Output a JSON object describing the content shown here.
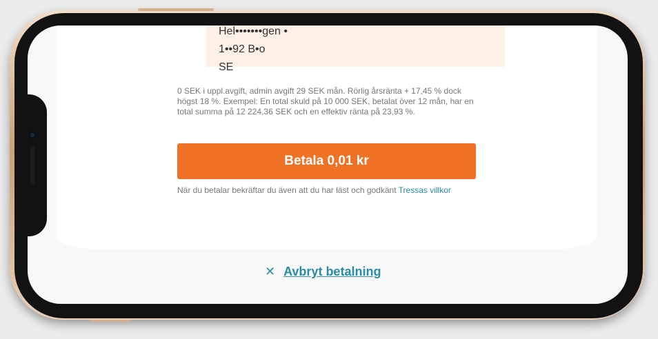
{
  "address": {
    "street": "Hel•••••••gen •",
    "postal": "1••92 B•o",
    "country": "SE"
  },
  "disclaimer": "0 SEK i uppl.avgift, admin avgift 29 SEK mån. Rörlig årsränta + 17,45 % dock högst 18 %. Exempel: En total skuld på 10 000 SEK, betalat över 12 mån, har en total summa på 12 224,36 SEK och en effektiv ränta på 23,93 %.",
  "pay_button": {
    "label": "Betala 0,01 kr",
    "color": "#ef7227"
  },
  "terms": {
    "text": "När du betalar bekräftar du även att du har läst och godkänt",
    "link": "Tressas villkor"
  },
  "cancel": {
    "icon": "✕",
    "label": "Avbryt betalning"
  },
  "colors": {
    "accent": "#2a8ba3",
    "address_bg": "#fdf1e6"
  }
}
